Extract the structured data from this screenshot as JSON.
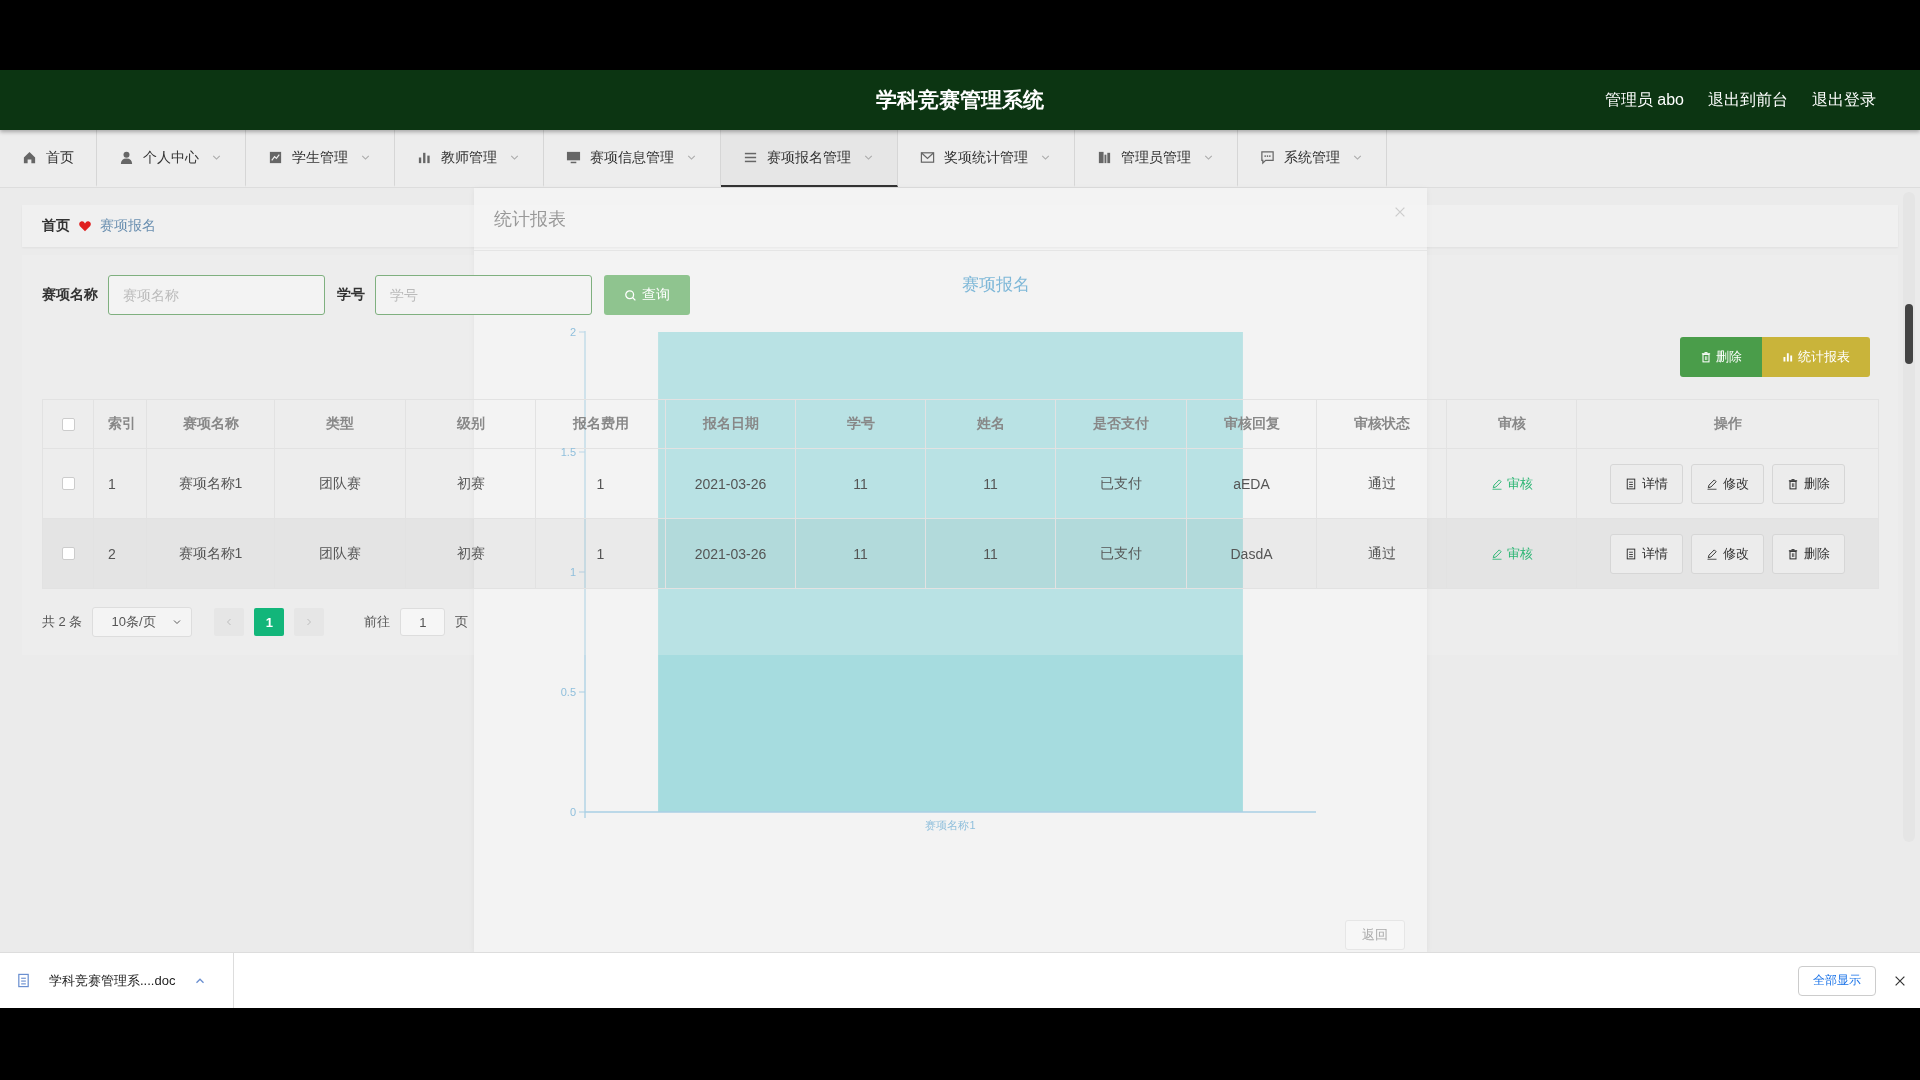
{
  "header": {
    "title": "学科竞赛管理系统",
    "links": [
      "管理员 abo",
      "退出到前台",
      "退出登录"
    ]
  },
  "nav": [
    {
      "label": "首页",
      "selected": false,
      "dropdown": false
    },
    {
      "label": "个人中心",
      "selected": false,
      "dropdown": true
    },
    {
      "label": "学生管理",
      "selected": false,
      "dropdown": true
    },
    {
      "label": "教师管理",
      "selected": false,
      "dropdown": true
    },
    {
      "label": "赛项信息管理",
      "selected": false,
      "dropdown": true
    },
    {
      "label": "赛项报名管理",
      "selected": true,
      "dropdown": true
    },
    {
      "label": "奖项统计管理",
      "selected": false,
      "dropdown": true
    },
    {
      "label": "管理员管理",
      "selected": false,
      "dropdown": true
    },
    {
      "label": "系统管理",
      "selected": false,
      "dropdown": true
    }
  ],
  "breadcrumb": [
    "首页",
    "赛项报名"
  ],
  "search": {
    "fields": [
      {
        "label": "赛项名称",
        "placeholder": "赛项名称"
      },
      {
        "label": "学号",
        "placeholder": "学号"
      }
    ],
    "button": "查询"
  },
  "toolbar": [
    {
      "kind": "delete",
      "label": "删除"
    },
    {
      "kind": "report",
      "label": "统计报表"
    }
  ],
  "table": {
    "select_all_checked": false,
    "columns": [
      "索引",
      "赛项名称",
      "类型",
      "级别",
      "报名费用",
      "报名日期",
      "学号",
      "姓名",
      "是否支付",
      "审核回复",
      "审核状态",
      "审核",
      "操作"
    ],
    "rows": [
      {
        "checked": false,
        "cells": [
          "1",
          "赛项名称1",
          "团队赛",
          "初赛",
          "1",
          "2021-03-26",
          "11",
          "11",
          "已支付",
          "aEDA",
          "通过"
        ],
        "review": "审核",
        "actions": [
          "详情",
          "修改",
          "删除"
        ]
      },
      {
        "checked": false,
        "cells": [
          "2",
          "赛项名称1",
          "团队赛",
          "初赛",
          "1",
          "2021-03-26",
          "11",
          "11",
          "已支付",
          "DasdA",
          "通过"
        ],
        "review": "审核",
        "actions": [
          "详情",
          "修改",
          "删除"
        ]
      }
    ]
  },
  "pager": {
    "total": "共 2 条",
    "page_size": "10条/页",
    "pages": [
      {
        "label": "1",
        "selected": true
      }
    ],
    "goto": "前往",
    "page": "1",
    "page_suffix": "页"
  },
  "modal": {
    "title": "统计报表",
    "chart_data": {
      "type": "bar",
      "title": "赛项报名",
      "categories": [
        "赛项名称1"
      ],
      "values": [
        2
      ],
      "ylim": [
        0,
        2
      ],
      "yticks": [
        0,
        0.5,
        1,
        1.5,
        2
      ]
    },
    "button": "返回"
  },
  "download_bar": {
    "file": "学科竞赛管理系....doc",
    "show_all": "全部显示"
  }
}
